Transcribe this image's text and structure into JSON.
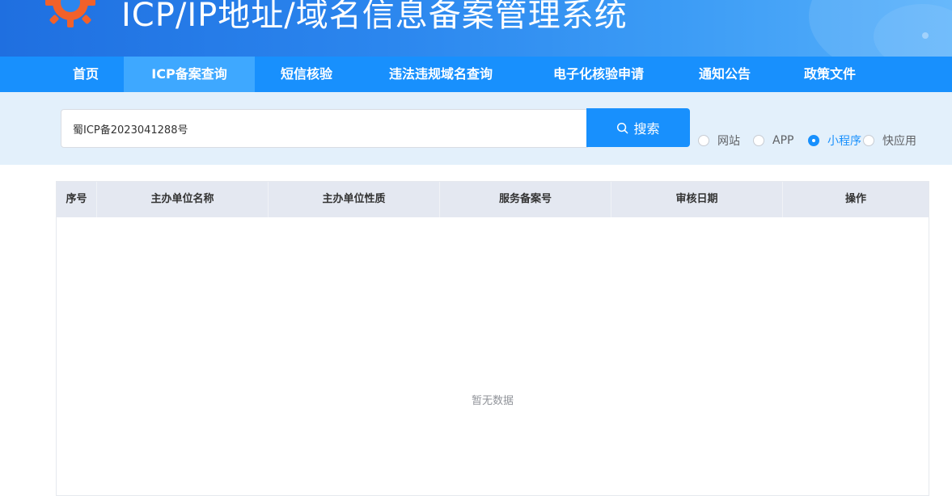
{
  "header": {
    "title": "ICP/IP地址/域名信息备案管理系统",
    "logo_icon": "gear-logo-icon",
    "accent": "#1890fd"
  },
  "nav": {
    "items": [
      {
        "label": "首页",
        "active": false
      },
      {
        "label": "ICP备案查询",
        "active": true
      },
      {
        "label": "短信核验",
        "active": false
      },
      {
        "label": "违法违规域名查询",
        "active": false
      },
      {
        "label": "电子化核验申请",
        "active": false
      },
      {
        "label": "通知公告",
        "active": false
      },
      {
        "label": "政策文件",
        "active": false
      }
    ]
  },
  "search": {
    "value": "蜀ICP备2023041288号",
    "button_label": "搜索",
    "button_icon": "search-icon",
    "types": [
      {
        "label": "网站",
        "checked": false
      },
      {
        "label": "APP",
        "checked": false
      },
      {
        "label": "小程序",
        "checked": true
      },
      {
        "label": "快应用",
        "checked": false
      }
    ]
  },
  "table": {
    "columns": [
      "序号",
      "主办单位名称",
      "主办单位性质",
      "服务备案号",
      "审核日期",
      "操作"
    ],
    "rows": [],
    "empty_text": "暂无数据"
  }
}
